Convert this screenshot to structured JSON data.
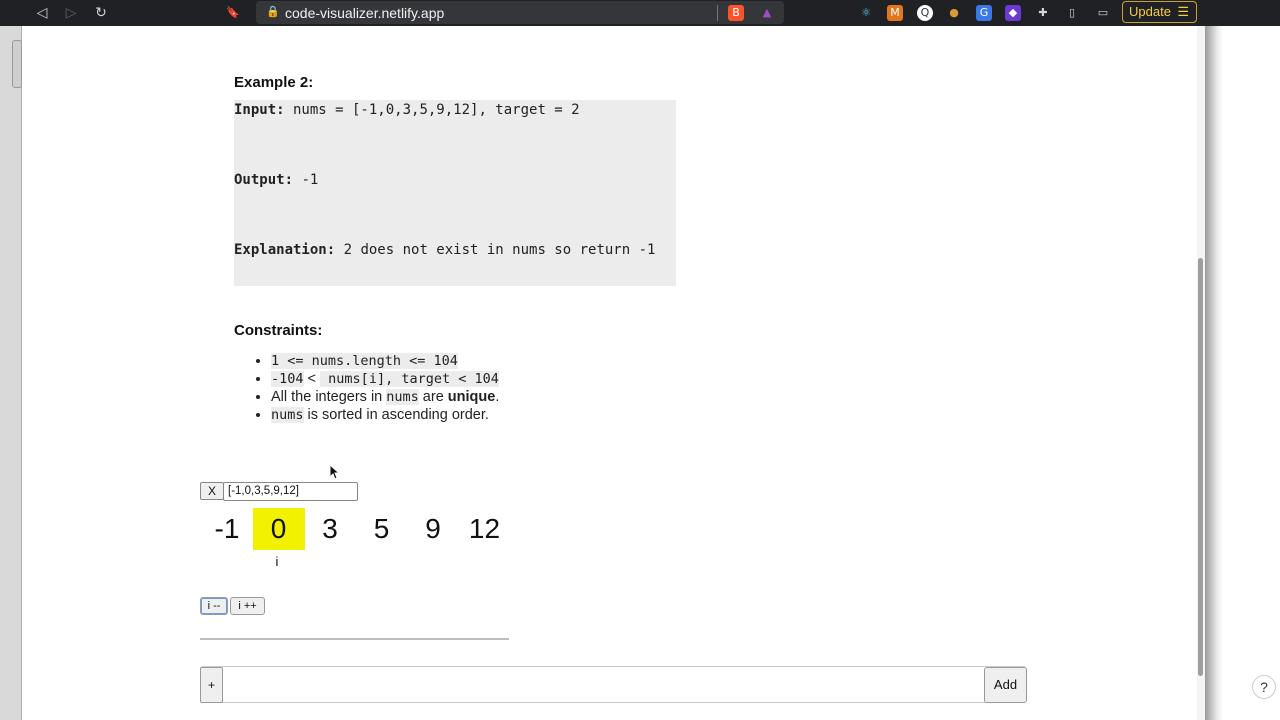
{
  "browser": {
    "url": "code-visualizer.netlify.app",
    "update_label": "Update",
    "update_menu_glyph": "☰",
    "icons": {
      "back": "◁",
      "forward": "▷",
      "reload": "↻",
      "bookmark": "🔖",
      "lock": "🔒",
      "brave": "B",
      "rewards": "▲",
      "react": "⚛",
      "metamask": "M",
      "ext_q": "Q",
      "cookie": "●",
      "translate": "G",
      "purple": "◆",
      "puzzle": "✚",
      "sidebar": "▯",
      "wallet": "▭"
    }
  },
  "example2": {
    "heading": "Example 2:",
    "input_label": "Input:",
    "input_value": " nums = [-1,0,3,5,9,12], target = 2",
    "output_label": "Output:",
    "output_value": " -1",
    "explanation_label": "Explanation:",
    "explanation_value": " 2 does not exist in nums so return -1"
  },
  "constraints": {
    "heading": "Constraints:",
    "item1_code": "1 <= nums.length <= 104",
    "item2_code_a": "-104",
    "item2_code_b": " nums[i], target < 104",
    "item2_lt": " < ",
    "item3_pre": "All the integers in ",
    "item3_code": "nums",
    "item3_mid": " are ",
    "item3_bold": "unique",
    "item3_post": ".",
    "item4_code": "nums",
    "item4_post": " is sorted in ascending order."
  },
  "visualizer": {
    "close_label": "X",
    "array_input_value": "[-1,0,3,5,9,12]",
    "cells": [
      "-1",
      "0",
      "3",
      "5",
      "9",
      "12"
    ],
    "active_index": 1,
    "pointer_label": "i",
    "dec_label": "i --",
    "inc_label": "i ++"
  },
  "add_bar": {
    "plus_label": "+",
    "input_value": "",
    "add_label": "Add"
  },
  "help_label": "?",
  "colors": {
    "highlight": "#f2f200",
    "code_bg": "#ececec"
  }
}
